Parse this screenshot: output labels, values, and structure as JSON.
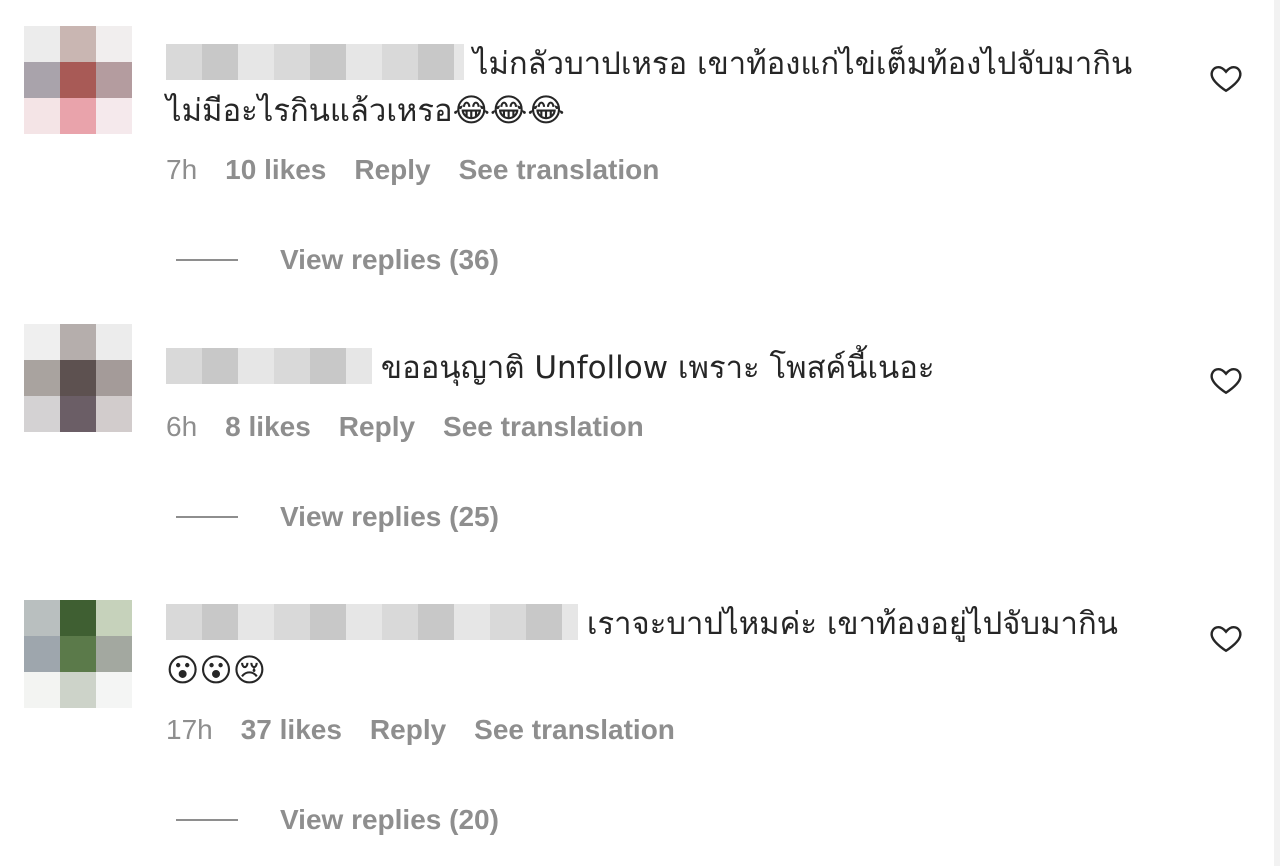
{
  "comments": [
    {
      "text": "ไม่กลัวบาปเหรอ เขาท้องแก่ไข่เต็มท้องไปจับมากิน ไม่มีอะไรกินแล้วเหรอ",
      "emoji": "😂😂😂",
      "time": "7h",
      "likes": "10 likes",
      "reply": "Reply",
      "translate": "See translation",
      "view_replies": "View replies (36)"
    },
    {
      "text": "ขออนุญาติ Unfollow เพราะ โพสค์นี้เนอะ",
      "emoji": "",
      "time": "6h",
      "likes": "8 likes",
      "reply": "Reply",
      "translate": "See translation",
      "view_replies": "View replies (25)"
    },
    {
      "text": "เราจะบาปไหมค่ะ เขาท้องอยู่ไปจับมากิน",
      "emoji": "😮😮😢",
      "time": "17h",
      "likes": "37 likes",
      "reply": "Reply",
      "translate": "See translation",
      "view_replies": "View replies (20)"
    }
  ],
  "icons": {
    "like": "heart-outline-icon"
  },
  "colors": {
    "text": "#262626",
    "secondary": "#8e8e8e"
  }
}
